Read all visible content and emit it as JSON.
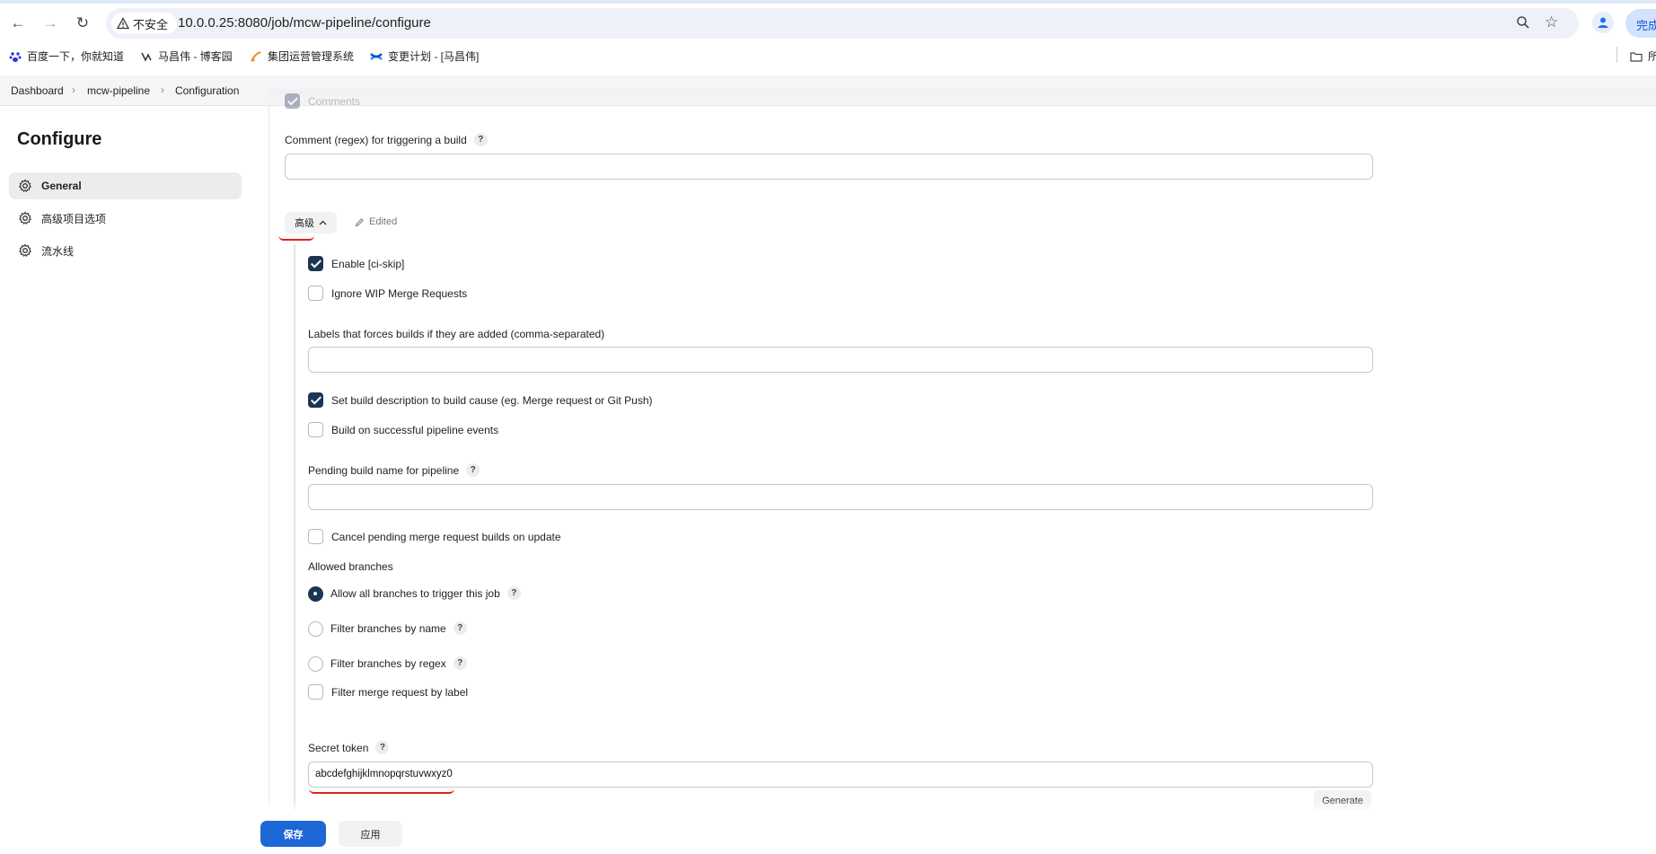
{
  "browser": {
    "security_label": "不安全",
    "url": "10.0.0.25:8080/job/mcw-pipeline/configure",
    "profile_button_label": "完成",
    "bookmarks": [
      {
        "label": "百度一下，你就知道",
        "icon": "baidu-paw-icon",
        "color": "#2932e1"
      },
      {
        "label": "马昌伟 - 博客园",
        "icon": "cnblogs-icon",
        "color": "#333333"
      },
      {
        "label": "集团运营管理系统",
        "icon": "system-logo-icon",
        "color": "#f08a24"
      },
      {
        "label": "变更计划 - [马昌伟]",
        "icon": "confluence-icon",
        "color": "#2684ff"
      }
    ],
    "overflow_bookmark": "所"
  },
  "breadcrumb": {
    "items": [
      "Dashboard",
      "mcw-pipeline",
      "Configuration"
    ]
  },
  "sidebar": {
    "title": "Configure",
    "items": [
      {
        "label": "General",
        "active": true
      },
      {
        "label": "高级项目选项",
        "active": false
      },
      {
        "label": "流水线",
        "active": false
      }
    ]
  },
  "form": {
    "comments_label": "Comments",
    "comment_regex_label": "Comment (regex) for triggering a build",
    "comment_regex_value": "",
    "advanced_button_label": "高级",
    "edited_label": "Edited",
    "enable_ci_skip": {
      "label": "Enable [ci-skip]",
      "checked": true
    },
    "ignore_wip": {
      "label": "Ignore WIP Merge Requests",
      "checked": false
    },
    "labels_force_label": "Labels that forces builds if they are added (comma-separated)",
    "labels_force_value": "",
    "set_build_description": {
      "label": "Set build description to build cause (eg. Merge request or Git Push)",
      "checked": true
    },
    "build_on_pipeline": {
      "label": "Build on successful pipeline events",
      "checked": false
    },
    "pending_build_name_label": "Pending build name for pipeline",
    "pending_build_name_value": "",
    "cancel_pending": {
      "label": "Cancel pending merge request builds on update",
      "checked": false
    },
    "allowed_branches_label": "Allowed branches",
    "branch_options": [
      {
        "label": "Allow all branches to trigger this job",
        "selected": true
      },
      {
        "label": "Filter branches by name",
        "selected": false
      },
      {
        "label": "Filter branches by regex",
        "selected": false
      }
    ],
    "filter_by_label": {
      "label": "Filter merge request by label",
      "checked": false
    },
    "secret_token_label": "Secret token",
    "secret_token_value": "abcdefghijklmnopqrstuvwxyz0",
    "generate_label": "Generate",
    "help_symbol": "?"
  },
  "footer": {
    "save_label": "保存",
    "apply_label": "应用"
  },
  "colors": {
    "primary": "#1d67d6",
    "checked": "#1c3553",
    "annotation": "#e02020"
  }
}
